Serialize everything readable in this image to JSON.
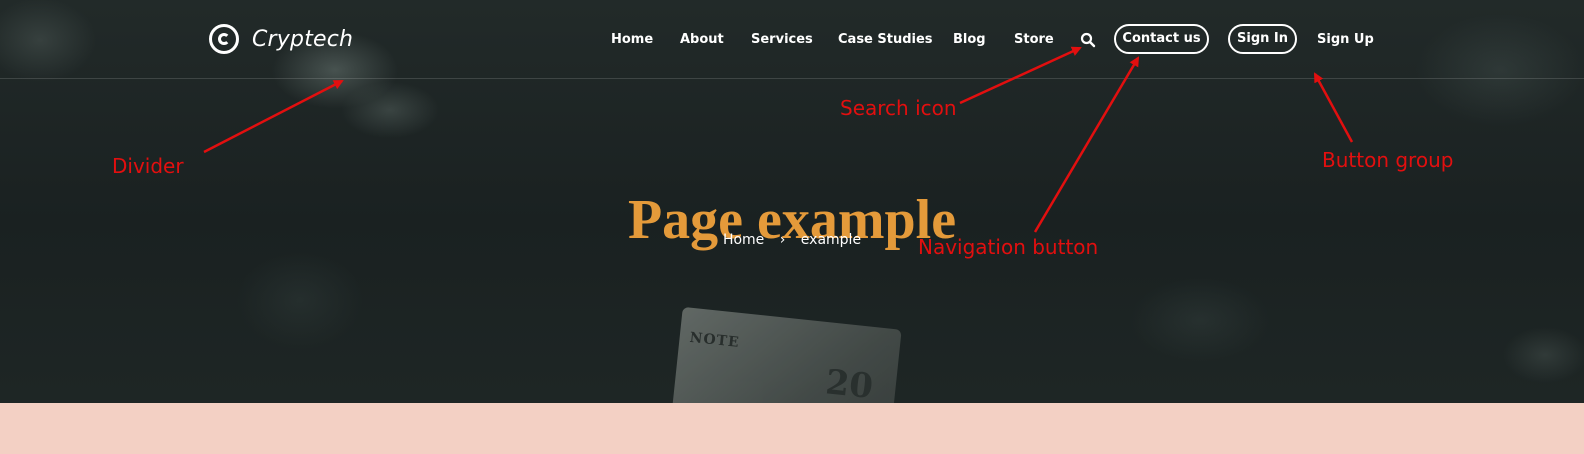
{
  "brand": {
    "name": "Cryptech",
    "logo_icon": "copyright-circle-icon"
  },
  "nav": {
    "items": [
      {
        "label": "Home"
      },
      {
        "label": "About"
      },
      {
        "label": "Services"
      },
      {
        "label": "Case Studies"
      },
      {
        "label": "Blog"
      },
      {
        "label": "Store"
      }
    ],
    "search_icon": "search-icon",
    "contact_label": "Contact us",
    "signin_label": "Sign In",
    "signup_label": "Sign Up"
  },
  "hero": {
    "title": "Page example",
    "breadcrumb": {
      "home": "Home",
      "separator": "›",
      "current": "example"
    },
    "background_text": {
      "note": "NOTE",
      "number": "20"
    }
  },
  "annotations": {
    "divider": "Divider",
    "search_icon": "Search icon",
    "button_group": "Button group",
    "navigation_button": "Navigation button"
  },
  "colors": {
    "title": "#e49a3a",
    "annotation": "#e20f0f",
    "hero_bg": "#1a2121",
    "footer_bg": "#f3d0c4",
    "nav_text": "#ffffff"
  }
}
